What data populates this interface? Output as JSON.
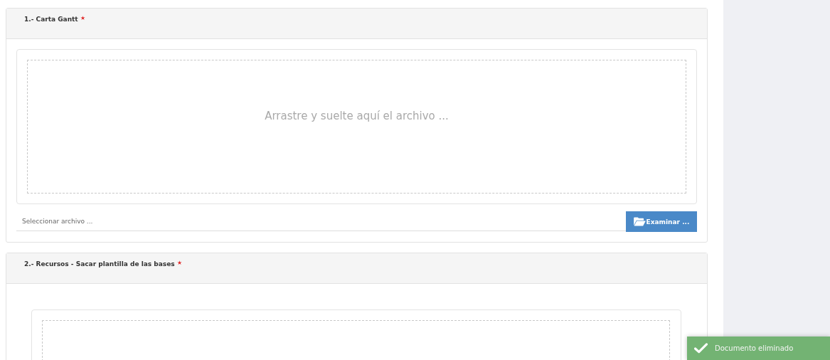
{
  "panels": [
    {
      "title": "1.- Carta Gantt",
      "required": true,
      "dropzone": {
        "text": "Arrastre y suelte aquí el archivo ..."
      },
      "file_field": {
        "placeholder": "Seleccionar archivo ..."
      },
      "browse_button": {
        "label": "Examinar ..."
      }
    },
    {
      "title": "2.- Recursos - Sacar plantilla de las bases",
      "required": true
    }
  ],
  "toast": {
    "kind": "success",
    "text": "Documento eliminado"
  }
}
